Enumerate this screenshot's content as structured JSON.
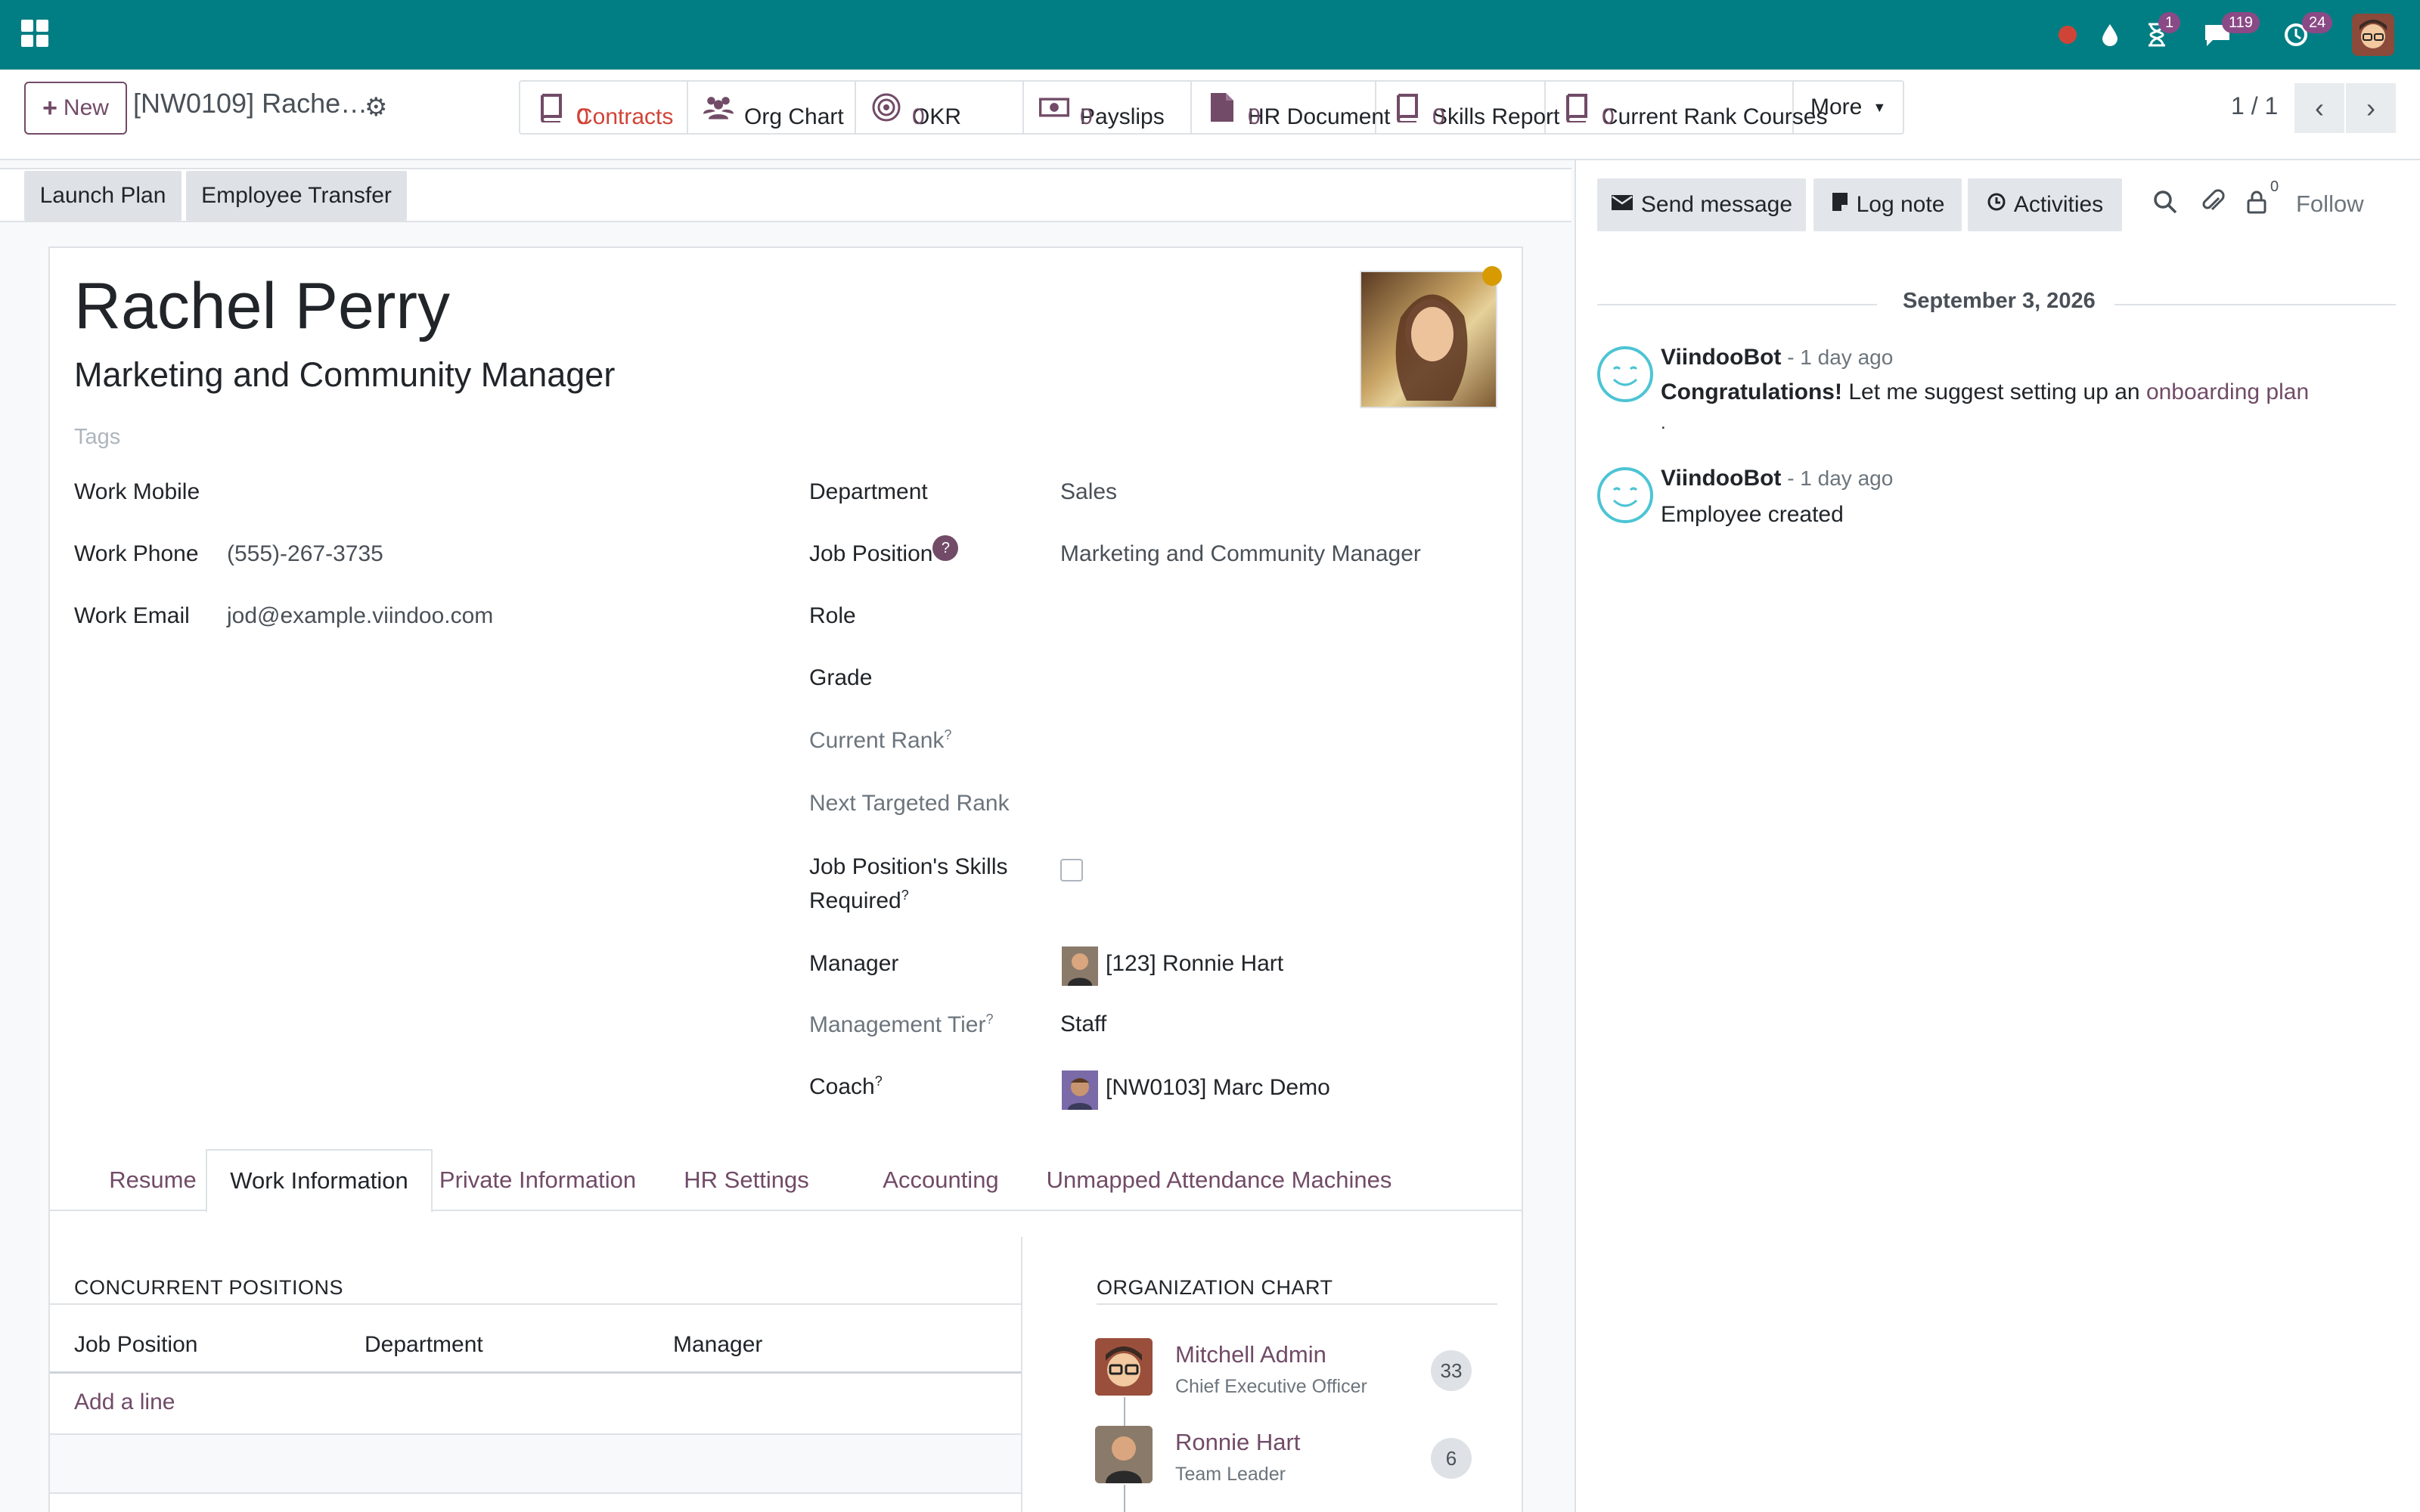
{
  "topbar": {
    "messages_badge": "119",
    "activities_badge": "1",
    "timer_badge": "24"
  },
  "control": {
    "new_label": "New",
    "breadcrumb": "[NW0109] Rache…",
    "smart_buttons": [
      {
        "label": "Contracts",
        "value": "0"
      },
      {
        "label": "Org Chart",
        "value": ""
      },
      {
        "label": "OKR",
        "value": "0"
      },
      {
        "label": "Payslips",
        "value": "0"
      },
      {
        "label": "HR Document",
        "value": "0"
      },
      {
        "label": "Skills Report",
        "value": "0"
      },
      {
        "label": "Current Rank Courses",
        "value": "0"
      }
    ],
    "more_label": "More",
    "pager": "1 / 1"
  },
  "header_buttons": {
    "launch_plan": "Launch Plan",
    "employee_transfer": "Employee Transfer"
  },
  "employee": {
    "name": "Rachel Perry",
    "job_title": "Marketing and Community Manager",
    "tags_placeholder": "Tags"
  },
  "left_fields": {
    "work_mobile_label": "Work Mobile",
    "work_phone_label": "Work Phone",
    "work_phone": "(555)-267-3735",
    "work_email_label": "Work Email",
    "work_email": "jod@example.viindoo.com"
  },
  "right_fields": {
    "department_label": "Department",
    "department": "Sales",
    "job_position_label": "Job Position",
    "job_position_help": "?",
    "job_position": "Marketing and Community Manager",
    "role_label": "Role",
    "grade_label": "Grade",
    "current_rank_label": "Current Rank",
    "next_rank_label": "Next Targeted Rank",
    "skills_required_label_1": "Job Position's Skills",
    "skills_required_label_2": "Required",
    "manager_label": "Manager",
    "manager": "[123] Ronnie Hart",
    "management_tier_label": "Management Tier",
    "management_tier": "Staff",
    "coach_label": "Coach",
    "coach": "[NW0103] Marc Demo",
    "help_mark": "?"
  },
  "tabs": [
    "Resume",
    "Work Information",
    "Private Information",
    "HR Settings",
    "Accounting",
    "Unmapped Attendance Machines"
  ],
  "work_info": {
    "concurrent_title": "CONCURRENT POSITIONS",
    "columns": [
      "Job Position",
      "Department",
      "Manager"
    ],
    "add_line": "Add a line",
    "org_chart_title": "ORGANIZATION CHART",
    "org_chart": [
      {
        "name": "Mitchell Admin",
        "role": "Chief Executive Officer",
        "count": "33"
      },
      {
        "name": "Ronnie Hart",
        "role": "Team Leader",
        "count": "6"
      }
    ]
  },
  "chatter": {
    "send_message": "Send message",
    "log_note": "Log note",
    "activities": "Activities",
    "followers_count": "0",
    "follow": "Follow",
    "date": "September 3, 2026",
    "messages": [
      {
        "author": "ViindooBot",
        "time": " - 1 day ago",
        "bold": "Congratulations!",
        "text": " Let me suggest setting up an ",
        "link": "onboarding plan",
        "trail": "."
      },
      {
        "author": "ViindooBot",
        "time": " - 1 day ago",
        "text": "Employee created"
      }
    ]
  },
  "colors": {
    "navbar": "#017e84",
    "primary": "#714b67",
    "danger": "#d04437",
    "status_dot": "#d79a00",
    "bot_icon": "#4cc4d4"
  },
  "icons": [
    "app-menu-icon",
    "record-icon",
    "drop-icon",
    "hourglass-icon",
    "chat-icon",
    "clock-icon",
    "gear-icon",
    "book-icon",
    "users-icon",
    "target-icon",
    "money-icon",
    "file-icon",
    "chevron-left-icon",
    "chevron-right-icon",
    "envelope-icon",
    "note-icon",
    "clock-circle-icon",
    "search-icon",
    "paperclip-icon",
    "lock-icon",
    "smiley-icon"
  ]
}
